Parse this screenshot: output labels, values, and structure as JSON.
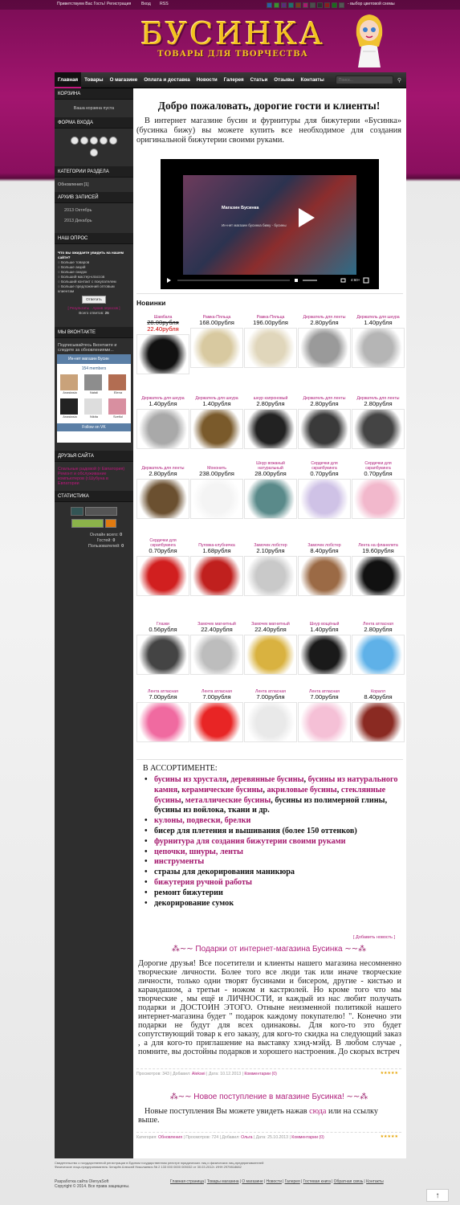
{
  "top": {
    "greet": "Приветствуем Вас Гость!",
    "register": "Регистрация",
    "login": "Вход",
    "rss": "RSS",
    "scheme": "- выбор цветовой схемы",
    "swatches": [
      "#2b5aa7",
      "#3c8f2c",
      "#5b2a7a",
      "#1e6f6f",
      "#7a3b1b",
      "#a8186f",
      "#4d4d4d",
      "#2f2f2f",
      "#8a1c1c",
      "#1c6a1c",
      "#555555"
    ]
  },
  "logo": {
    "title": "БУСИНКА",
    "subtitle": "ТОВАРЫ ДЛЯ ТВОРЧЕСТВА"
  },
  "nav": {
    "items": [
      "Главная",
      "Товары",
      "О магазине",
      "Оплата и доставка",
      "Новости",
      "Галерея",
      "Статьи",
      "Отзывы",
      "Контакты"
    ],
    "search_placeholder": "Поиск..."
  },
  "sidebar": {
    "cart_title": "КОРЗИНА",
    "cart_text": "Ваша корзина пуста",
    "login_title": "ФОРМА ВХОДА",
    "cat_title": "КАТЕГОРИИ РАЗДЕЛА",
    "cat_item": "Обновления",
    "cat_count": "[1]",
    "archive_title": "АРХИВ ЗАПИСЕЙ",
    "archive": [
      "2013 Октябрь",
      "2013 Декабрь"
    ],
    "poll_title": "НАШ ОПРОС",
    "poll_q": "Что вы ожидаете увидеть на нашем сайте?",
    "poll_opts": [
      "Больше товаров",
      "Больше акций",
      "Больше скидок",
      "Больший мастер-классов",
      "Больший контакт с покупателем",
      "Больше предложений оптовым клиентам"
    ],
    "poll_btn": "Ответить",
    "poll_results": "Результаты",
    "poll_archive": "Архив опросов",
    "poll_total_label": "Всего ответов:",
    "poll_total": "25",
    "vk_title": "МЫ ВКОНТАКТЕ",
    "vk_text": "Подписывайтесь Вконтакте и следите за обновлениями...",
    "vk_group": "Ин-нет магазин Бусин",
    "vk_members": "154 members",
    "vk_people": [
      "Anastasia",
      "Natali",
      "Elena",
      "Anastasia",
      "Nikita",
      "Svetlol"
    ],
    "vk_follow": "Follow on VK",
    "friends_title": "ДРУЗЬЯ САЙТА",
    "friends": [
      "Спальные радовой (г Евпатория)",
      "Ремонт и обслуживание компьютеров (г.Шубуна в Евпатории"
    ],
    "stats_title": "СТАТИСТИКА",
    "online_label": "Онлайн всего:",
    "online": "0",
    "guests_label": "Гостей:",
    "guests": "0",
    "users_label": "Пользователей:",
    "users": "0"
  },
  "welcome": "Добро пожаловать, дорогие гости и клиенты!",
  "intro": "В интернет магазине бусин и фурнитуры для бижутерии «Бусинка» (бусинка бижу) вы можете купить все необходимое для создания оригинальной бижутерии своими руками.",
  "video": {
    "channel": "Магазин Бусинка",
    "title": "Ин-нет магазин бусинка бижу - бусины",
    "time": "4:60+"
  },
  "new_title": "Новинки",
  "products": [
    {
      "n": "Шамбала",
      "old": "28.00рубля",
      "p": "22.40рубля",
      "c": "#111"
    },
    {
      "n": "Рамка-Пяльца",
      "p": "168.00рубля",
      "c": "#d8c9a0"
    },
    {
      "n": "Рамка-Пяльца",
      "p": "196.00рубля",
      "c": "#e0d6bb"
    },
    {
      "n": "Держатель для ленты",
      "p": "2.80рубля",
      "c": "#9a9a9a"
    },
    {
      "n": "Держатель для шнура",
      "p": "1.40рубля",
      "c": "#b5b5b5"
    },
    {
      "n": "Держатель для шнура",
      "p": "1.40рубля",
      "c": "#a9a9a9"
    },
    {
      "n": "Держатель для шнура",
      "p": "1.40рубля",
      "c": "#7a5a2b"
    },
    {
      "n": "шнур капроновый",
      "p": "2.80рубля",
      "c": "#222"
    },
    {
      "n": "Держатель для ленты",
      "p": "2.80рубля",
      "c": "#3a3a3a"
    },
    {
      "n": "Держатель для ленты",
      "p": "2.80рубля",
      "c": "#444"
    },
    {
      "n": "Держатель для ленты",
      "p": "2.80рубля",
      "c": "#6b5030"
    },
    {
      "n": "Мононить",
      "p": "238.00рубля",
      "c": "#f4f4f4"
    },
    {
      "n": "Шнур вожаный натуральный",
      "p": "28.00рубля",
      "c": "#5a8a8a"
    },
    {
      "n": "Сердечки для скрапбукинга",
      "p": "0.70рубля",
      "c": "#cfc2e6"
    },
    {
      "n": "Сердечки для скрапбукинга",
      "p": "0.70рубля",
      "c": "#f2b8cc"
    },
    {
      "n": "Сердечки для скрапбукинга",
      "p": "0.70рубля",
      "c": "#d11f1f"
    },
    {
      "n": "Пуговка-клубничка",
      "p": "1.68рубля",
      "c": "#c0201e"
    },
    {
      "n": "Замочек лобстер",
      "p": "2.10рубля",
      "c": "#c9c9c9"
    },
    {
      "n": "Замочек лобстер",
      "p": "8.40рубля",
      "c": "#9b6a45"
    },
    {
      "n": "Лента на фланелета",
      "p": "19.60рубля",
      "c": "#111"
    },
    {
      "n": "Глазки",
      "p": "0.56рубля",
      "c": "#444"
    },
    {
      "n": "Замочек магнитный",
      "p": "22.40рубля",
      "c": "#bdbdbd"
    },
    {
      "n": "Замочек магнитный",
      "p": "22.40рубля",
      "c": "#d9b240"
    },
    {
      "n": "Шнур вощёный",
      "p": "1.40рубля",
      "c": "#1a1a1a"
    },
    {
      "n": "Лента атласная",
      "p": "2.80рубля",
      "c": "#5fb1e8"
    },
    {
      "n": "Лента атласная",
      "p": "7.00рубля",
      "c": "#f06aa0"
    },
    {
      "n": "Лента атласная",
      "p": "7.00рубля",
      "c": "#e82525"
    },
    {
      "n": "Лента атласная",
      "p": "7.00рубля",
      "c": "#e9e9e9"
    },
    {
      "n": "Лента атласная",
      "p": "7.00рубля",
      "c": "#f5c0d6"
    },
    {
      "n": "Коралл",
      "p": "8.40рубля",
      "c": "#8a2a22"
    }
  ],
  "assort_title": "В АССОРТИМЕНТЕ:",
  "assort": [
    [
      [
        "бусины из хрусталя",
        "pk"
      ],
      [
        ", ",
        "bk"
      ],
      [
        "деревянные бусины",
        "pk"
      ],
      [
        ",  ",
        "bk"
      ],
      [
        "бусины из натурального камня",
        "pk"
      ],
      [
        ",  ",
        "bk"
      ],
      [
        "керамические бусины",
        "pk"
      ],
      [
        ", ",
        "bk"
      ],
      [
        "акриловые бусины",
        "pk"
      ],
      [
        ",  ",
        "bk"
      ],
      [
        "стеклянные бусины",
        "pk"
      ],
      [
        ", ",
        "bk"
      ],
      [
        "металлические бусины",
        "pk"
      ],
      [
        ", бусины из полимерной глины, бусины из войлока, ткани и др.",
        "bk"
      ]
    ],
    [
      [
        "кулоны, подвески, брелки",
        "pk"
      ]
    ],
    [
      [
        "бисер для плетения и вышивания (более 150 оттенков)",
        "bk"
      ]
    ],
    [
      [
        "фурнитура для создания бижутерии своими руками",
        "pk"
      ]
    ],
    [
      [
        "цепочки, шнуры, ленты",
        "pk"
      ]
    ],
    [
      [
        "инструменты",
        "pk"
      ]
    ],
    [
      [
        "стразы для декорирования маникюра",
        "bk"
      ]
    ],
    [
      [
        "бижутерия ручной работы",
        "pk"
      ]
    ],
    [
      [
        "ремонт бижутерии",
        "bk"
      ]
    ],
    [
      [
        "декорирование сумок",
        "bk"
      ]
    ]
  ],
  "add_news": "[ Добавить новость ]",
  "news1": {
    "title": "Подарки от интернет-магазина Бусинка",
    "body": "Дорогие друзья! Все посетители и клиенты нашего магазина несомненно творческие личности. Более того все люди так или иначе творческие личности, только одни творят бусинами и бисером, другие - кистью и карандашом, а третьи - ножом и кастрюлей. Но кроме того что мы творческие , мы ещё и ЛИЧНОСТИ, и каждый из нас любит получать подарки и ДОСТОИН ЭТОГО. Отныне неизменной политикой нашего интернет-магазина будет \" подарок каждому покупателю! \". Конечно эти подарки не будут для всех одинаковы. Для кого-то это будет сопутствующий товар к его заказу, для кого-то скидка на следующий заказ , а для кого-то приглашение на выставку хэнд-мэйд. В любом случае , помните, вы достойны подарков и хорошего настроения. До скорых встреч",
    "meta": "Просмотров: 343 | Добавил: ",
    "author": "Aleksei",
    "meta2": " | Дата: 10.12.2013 | ",
    "comments": "Комментарии (0)"
  },
  "news2": {
    "title": "Новое поступление в магазине Бусинка!",
    "body": "Новые поступления Вы можете увидеть нажав ",
    "link": "сюда",
    "body2": " или на ссылку выше.",
    "cat_label": "Категория: ",
    "cat": "Обновления",
    "meta": " | Просмотров: 724 | Добавил: ",
    "author": "Ольга",
    "meta2": " | Дата: 25.10.2013 | ",
    "comments": "Комментарии (0)"
  },
  "footer": {
    "legal1": "Свидетельство о государственной регистрации в Едином государственном реестре юридических лиц и физических лиц-предпринимателей",
    "legal2": "Физическое лицо-предприниматель Чегарёв Алексей Николаевич № 2 133 000 0000 005032 от 30.03.2012г. ИНН 2979818682",
    "dev": "Разработка сайта OlenyaSoft",
    "copy": "Copyright © 2014. Все права защищены.",
    "links": [
      "Главная страница",
      "Товары магазина",
      "О магазине",
      "Новости",
      "Галерея",
      "Гостевая книга",
      "Обратная связь",
      "Контакты"
    ]
  }
}
